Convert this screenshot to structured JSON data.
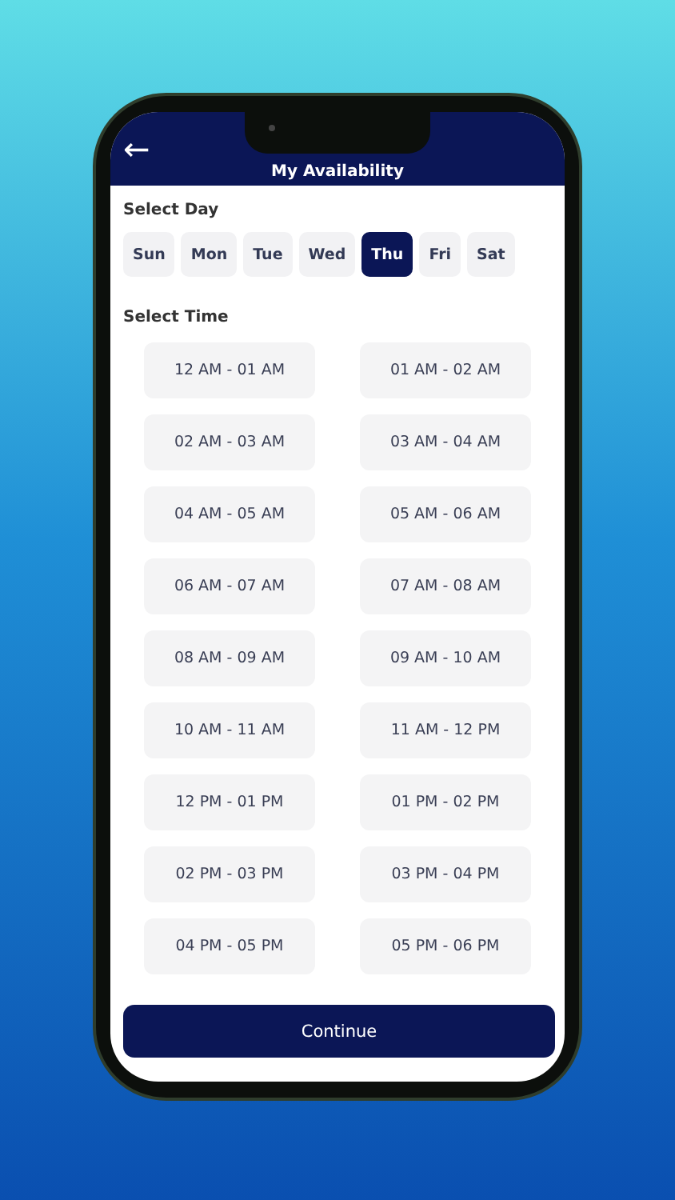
{
  "header": {
    "back": "←",
    "title": "My Availability"
  },
  "day_section": {
    "label": "Select Day"
  },
  "days": [
    {
      "label": "Sun",
      "selected": false
    },
    {
      "label": "Mon",
      "selected": false
    },
    {
      "label": "Tue",
      "selected": false
    },
    {
      "label": "Wed",
      "selected": false
    },
    {
      "label": "Thu",
      "selected": true
    },
    {
      "label": "Fri",
      "selected": false
    },
    {
      "label": "Sat",
      "selected": false
    }
  ],
  "time_section": {
    "label": "Select Time"
  },
  "time_slots": [
    "12 AM - 01 AM",
    "01 AM - 02 AM",
    "02 AM - 03 AM",
    "03 AM - 04 AM",
    "04 AM - 05 AM",
    "05 AM - 06 AM",
    "06 AM - 07 AM",
    "07 AM - 08 AM",
    "08 AM - 09 AM",
    "09 AM - 10 AM",
    "10 AM - 11 AM",
    "11 AM - 12 PM",
    "12 PM - 01 PM",
    "01 PM - 02 PM",
    "02 PM - 03 PM",
    "03 PM - 04 PM",
    "04 PM - 05 PM",
    "05 PM - 06 PM"
  ],
  "continue_button": "Continue"
}
